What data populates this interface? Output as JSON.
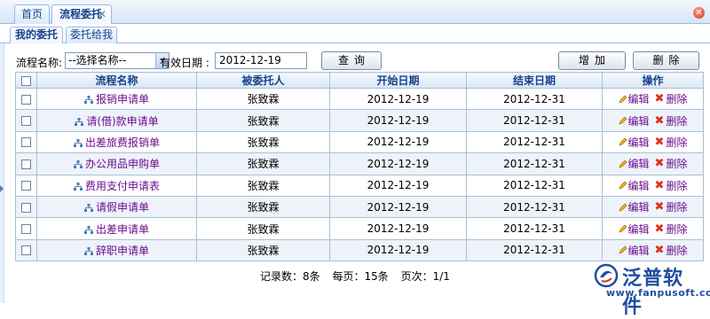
{
  "top_tabs": [
    {
      "label": "首页"
    },
    {
      "label": "流程委托",
      "close": "✕"
    }
  ],
  "window_close": "✕",
  "sub_tabs": [
    {
      "label": "我的委托"
    },
    {
      "label": "委托给我"
    }
  ],
  "toolbar": {
    "flow_name_label": "流程名称:",
    "flow_name_value": "--选择名称--",
    "valid_date_label": "有效日期 :",
    "valid_date_value": "2012-12-19",
    "query_button": "查询",
    "add_button": "增加",
    "delete_button": "删除"
  },
  "grid": {
    "columns": [
      "流程名称",
      "被委托人",
      "开始日期",
      "结束日期",
      "操作"
    ],
    "edit_label": "编辑",
    "delete_label": "删除",
    "rows": [
      {
        "name": "报销申请单",
        "delegate": "张致霖",
        "start": "2012-12-19",
        "end": "2012-12-31"
      },
      {
        "name": "请(借)款申请单",
        "delegate": "张致霖",
        "start": "2012-12-19",
        "end": "2012-12-31"
      },
      {
        "name": "出差旅费报销单",
        "delegate": "张致霖",
        "start": "2012-12-19",
        "end": "2012-12-31"
      },
      {
        "name": "办公用品申购单",
        "delegate": "张致霖",
        "start": "2012-12-19",
        "end": "2012-12-31"
      },
      {
        "name": "费用支付申请表",
        "delegate": "张致霖",
        "start": "2012-12-19",
        "end": "2012-12-31"
      },
      {
        "name": "请假申请单",
        "delegate": "张致霖",
        "start": "2012-12-19",
        "end": "2012-12-31"
      },
      {
        "name": "出差申请单",
        "delegate": "张致霖",
        "start": "2012-12-19",
        "end": "2012-12-31"
      },
      {
        "name": "辞职申请单",
        "delegate": "张致霖",
        "start": "2012-12-19",
        "end": "2012-12-31"
      }
    ]
  },
  "pager": {
    "records": "记录数：8条",
    "per_page": "每页：15条",
    "page": "页次：1/1"
  },
  "logo": {
    "brand": "泛普软件",
    "url": "www.fanpusoft.com"
  },
  "colors": {
    "link": "#6b0d8e",
    "header_text": "#15428b",
    "border": "#a9bfd6",
    "alt_row": "#eef3fa",
    "delete_icon": "#e0301e",
    "logo": "#1f4ea1"
  }
}
